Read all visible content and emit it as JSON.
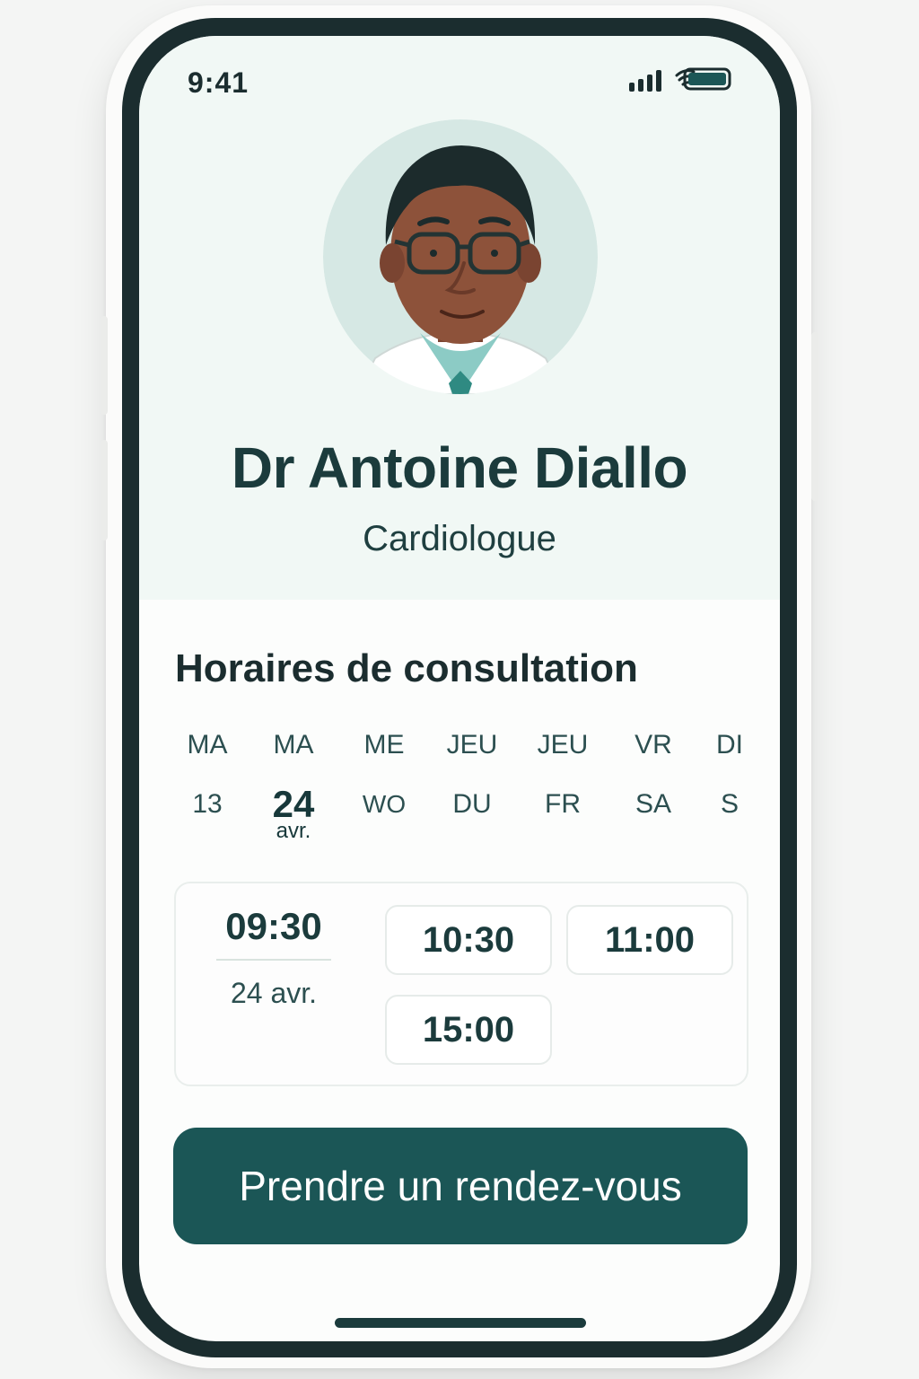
{
  "status_bar": {
    "time": "9:41"
  },
  "doctor": {
    "name": "Dr Antoine Diallo",
    "specialty": "Cardiologue"
  },
  "schedule": {
    "title": "Horaires de consultation",
    "days": [
      {
        "name": "MA",
        "sub": "13"
      },
      {
        "name": "MA",
        "sub": "24",
        "month": "avr.",
        "selected": true
      },
      {
        "name": "ME",
        "sub": "WO"
      },
      {
        "name": "JEU",
        "sub": "DU"
      },
      {
        "name": "JEU",
        "sub": "FR"
      },
      {
        "name": "VR",
        "sub": "SA"
      },
      {
        "name": "DI",
        "sub": "S"
      }
    ]
  },
  "slots": {
    "selected": {
      "time": "09:30",
      "date": "24 avr."
    },
    "options": [
      "10:30",
      "11:00",
      "15:00"
    ]
  },
  "cta": {
    "label": "Prendre un rendez-vous"
  },
  "colors": {
    "accent": "#1b5656",
    "header_bg": "#f1f8f5",
    "text": "#1b3b3c"
  }
}
